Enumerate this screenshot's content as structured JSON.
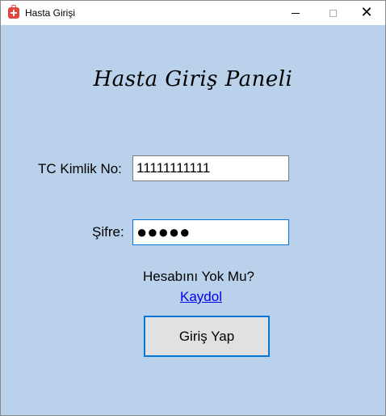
{
  "window": {
    "title": "Hasta Girişi",
    "icon": "medical-bag-icon",
    "close_glyph": "✕"
  },
  "form": {
    "heading": "Hasta Giriş Paneli",
    "tc_label": "TC Kimlik No:",
    "tc_value": "11111111111",
    "password_label": "Şifre:",
    "password_mask": "●●●●●",
    "no_account_prompt": "Hesabını Yok Mu?",
    "register_link": "Kaydol",
    "login_button": "Giriş Yap"
  },
  "colors": {
    "background": "#b9d1ea",
    "focus_border": "#0078d7",
    "link": "#0000ee"
  }
}
